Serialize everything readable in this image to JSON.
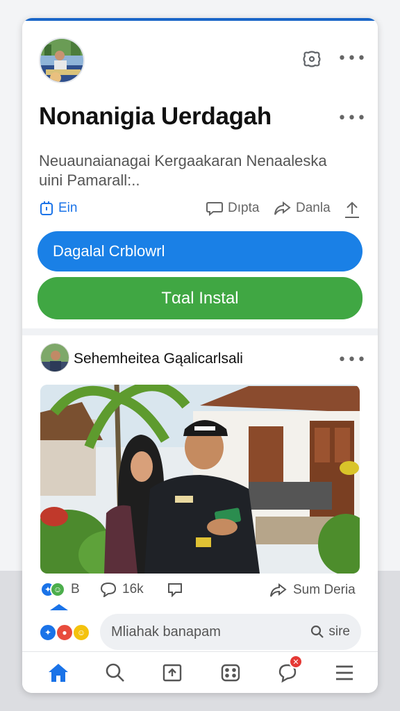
{
  "header": {
    "title": "Nonanigia Uerdagah",
    "description": "Neuaunaianagai  Kergaakaran Nenaaleska uini Pamarall:.."
  },
  "actions": {
    "ein": "Ein",
    "dipta": "Dıpta",
    "danla": "Danla"
  },
  "buttons": {
    "primary": "Dagalal Crblowrl",
    "install": "Tαal Instal"
  },
  "post": {
    "author": "Sehemheitea Gąalicarlsali",
    "likes": "B",
    "comments": "16k",
    "share": "Sum Deria"
  },
  "comment_input": {
    "placeholder": "Mliahak banapam",
    "action": "sire"
  },
  "colors": {
    "accent": "#1a80e6",
    "install": "#40a743",
    "badge": "#e53935"
  },
  "nav": {
    "items": [
      "home-icon",
      "search-icon",
      "upload-icon",
      "games-icon",
      "notifications-icon",
      "menu-icon"
    ]
  }
}
